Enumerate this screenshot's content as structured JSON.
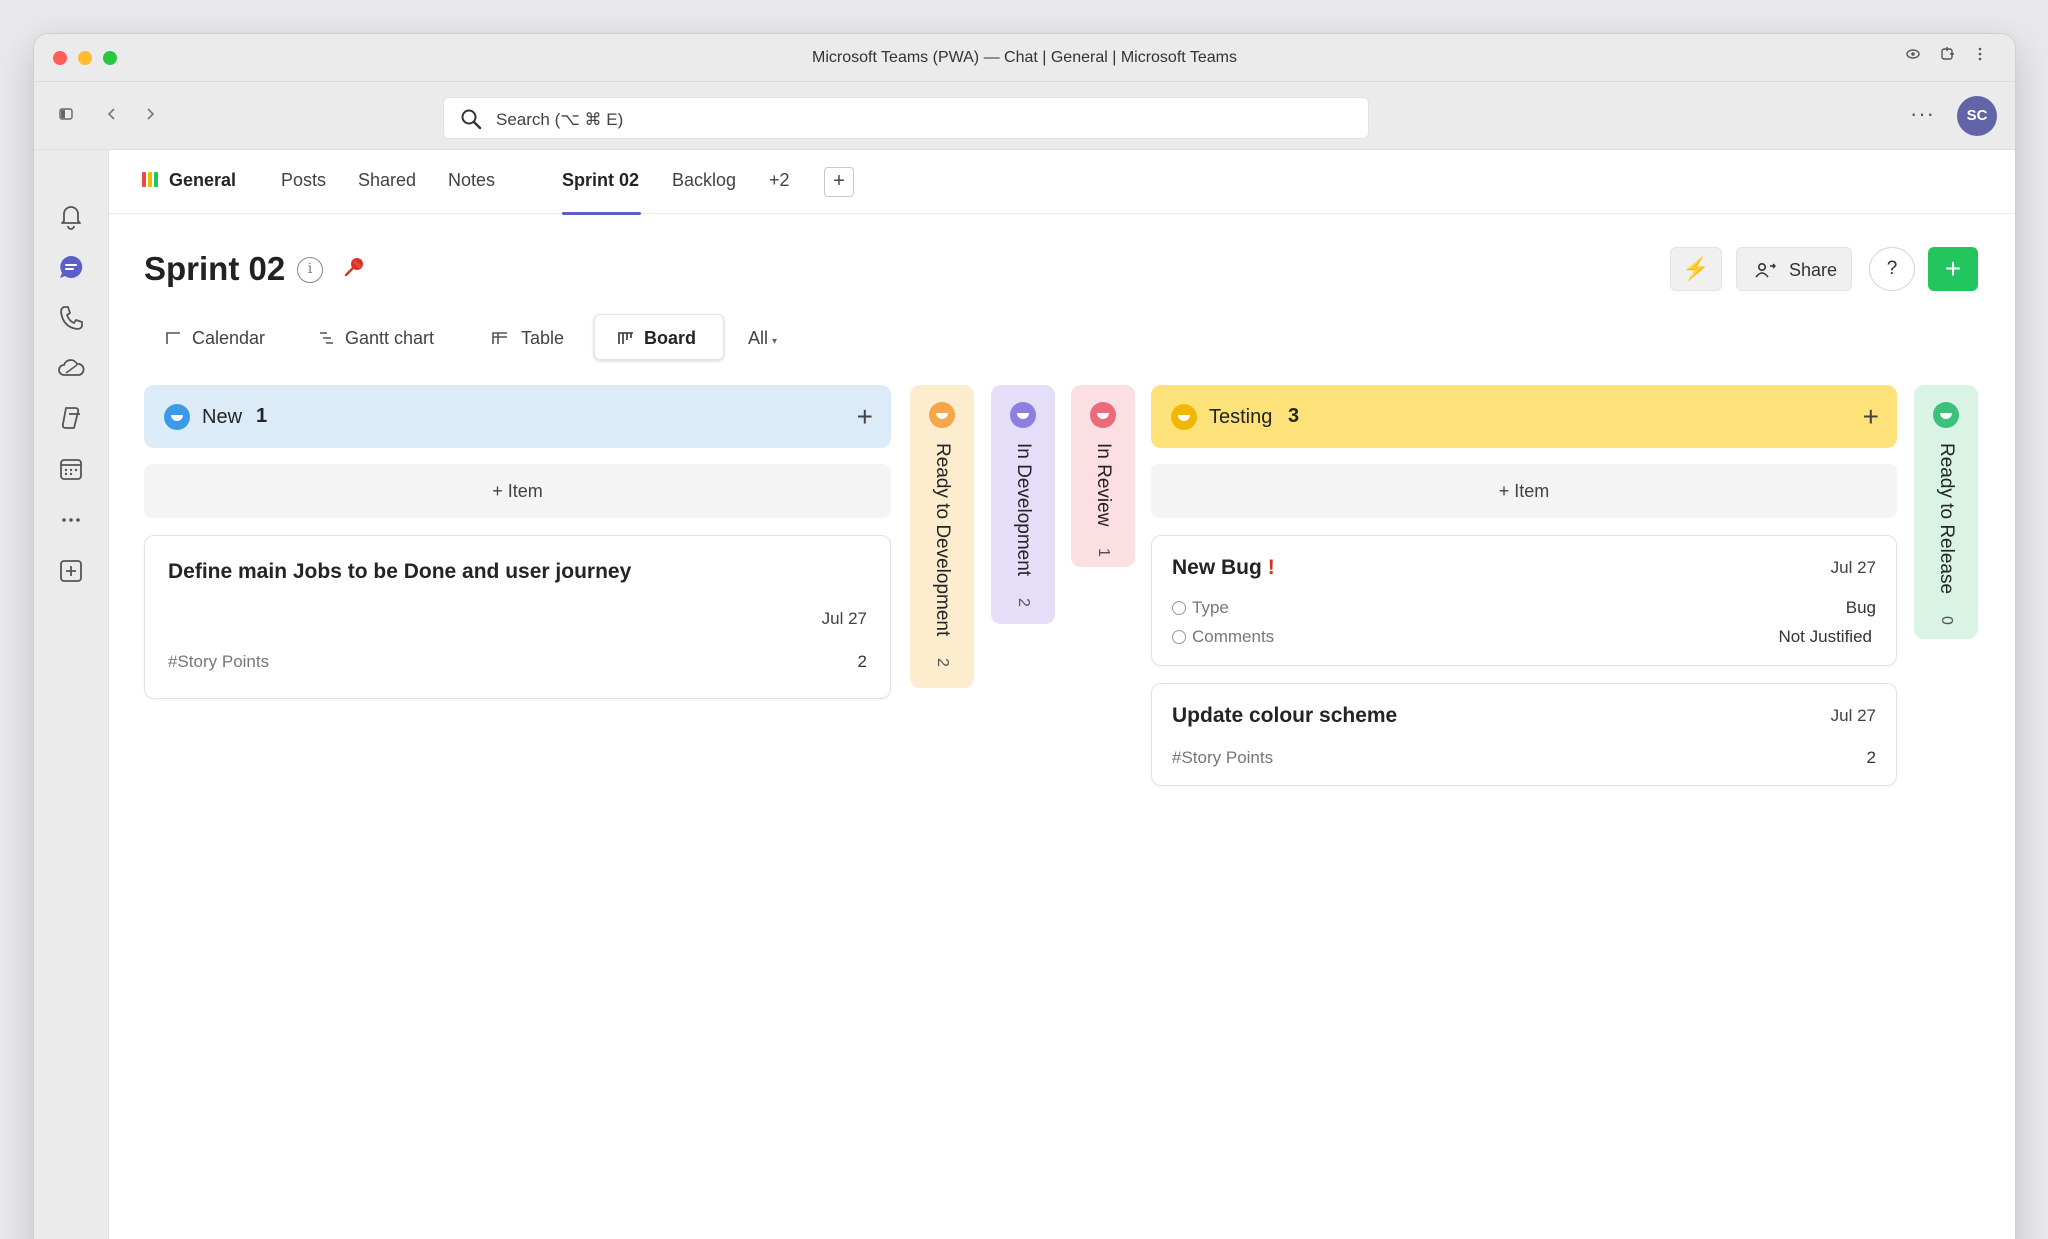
{
  "window": {
    "title": "Microsoft Teams (PWA) — Chat | General | Microsoft Teams"
  },
  "search": {
    "placeholder": "Search (⌥ ⌘ E)"
  },
  "user": {
    "initials": "SC"
  },
  "tabs": {
    "channel": "General",
    "items": [
      {
        "label": "Posts"
      },
      {
        "label": "Shared"
      },
      {
        "label": "Notes"
      },
      {
        "label": "Sprint 02"
      },
      {
        "label": "Backlog"
      },
      {
        "label": "+2"
      }
    ],
    "active": "Sprint 02",
    "add_label": "+"
  },
  "page": {
    "title": "Sprint 02",
    "share_label": "Share",
    "help_label": "?",
    "add_label": "+",
    "bolt_label": "⚡"
  },
  "views": [
    {
      "label": "Calendar",
      "icon": "calendar-view-icon"
    },
    {
      "label": "Gantt chart",
      "icon": "gantt-icon"
    },
    {
      "label": "Table",
      "icon": "table-icon"
    },
    {
      "label": "Board",
      "icon": "board-icon",
      "selected": true
    },
    {
      "label": "All",
      "icon": "dropdown-caret"
    }
  ],
  "colors": {
    "accent": "#5b5fc7",
    "new_header": "#dcebf8",
    "testing_header": "#fde27a",
    "ready_dev": "#fdeccd",
    "in_dev": "#e4def9",
    "in_review": "#fbdfe3",
    "ready_release": "#d9f3e4",
    "add_button": "#22c55e"
  },
  "board": {
    "columns": [
      {
        "name": "New",
        "count": "1",
        "add_item_label": "+ Item",
        "cards": [
          {
            "title": "Define main Jobs to be Done and user journey",
            "date": "Jul 27",
            "prop_label": "#Story Points",
            "prop_value": "2"
          }
        ]
      },
      {
        "name": "Ready to Development",
        "count": "2",
        "collapsed": true
      },
      {
        "name": "In Development",
        "count": "2",
        "collapsed": true
      },
      {
        "name": "In Review",
        "count": "1",
        "collapsed": true
      },
      {
        "name": "Testing",
        "count": "3",
        "add_item_label": "+ Item",
        "cards": [
          {
            "title": "New Bug",
            "flag": "!",
            "date": "Jul 27",
            "type_label": "Type",
            "type_value": "Bug",
            "comments_label": "Comments",
            "comments_value": "Not Justified"
          },
          {
            "title": "Update colour scheme",
            "date": "Jul 27",
            "prop_label": "#Story Points",
            "prop_value": "2"
          }
        ]
      },
      {
        "name": "Ready to Release",
        "count": "0",
        "collapsed": true
      }
    ]
  }
}
